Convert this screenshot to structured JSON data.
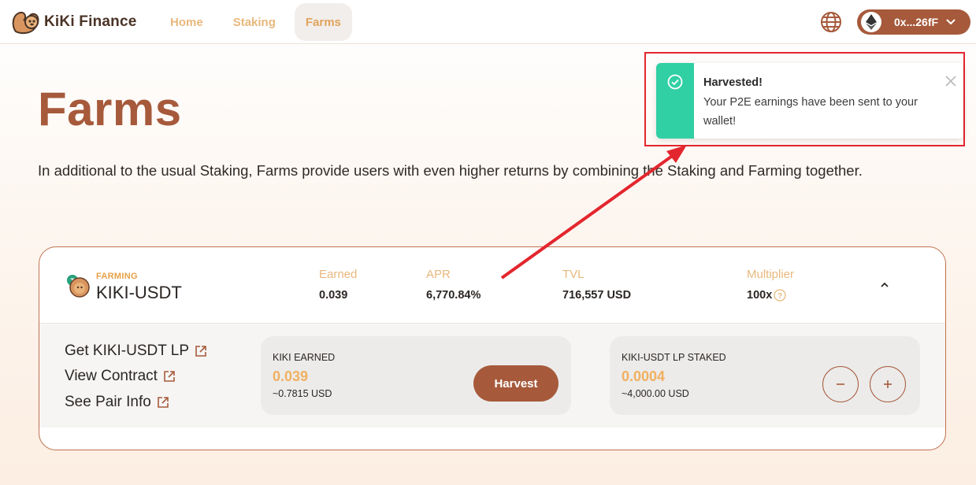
{
  "header": {
    "brand": "KiKi Finance",
    "nav": [
      {
        "label": "Home",
        "active": false
      },
      {
        "label": "Staking",
        "active": false
      },
      {
        "label": "Farms",
        "active": true
      }
    ],
    "wallet_address": "0x...26fF",
    "icons": [
      "squirrel-logo-icon",
      "globe-icon",
      "ethereum-icon",
      "chevron-down-icon"
    ]
  },
  "page": {
    "title": "Farms",
    "description": "In additional to the usual Staking, Farms provide users with even higher returns by combining the Staking and Farming together."
  },
  "toast": {
    "title": "Harvested!",
    "message": "Your P2E earnings have been sent to your wallet!",
    "accent": "#31cfa4"
  },
  "farm": {
    "tag": "FARMING",
    "pair": "KIKI-USDT",
    "stats": [
      {
        "label": "Earned",
        "value": "0.039"
      },
      {
        "label": "APR",
        "value": "6,770.84%"
      },
      {
        "label": "TVL",
        "value": "716,557 USD"
      },
      {
        "label": "Multiplier",
        "value": "100x"
      }
    ],
    "links": [
      "Get KIKI-USDT LP",
      "View Contract",
      "See Pair Info"
    ],
    "earned_panel": {
      "label": "KIKI EARNED",
      "value": "0.039",
      "usd": "~0.7815 USD",
      "button": "Harvest"
    },
    "staked_panel": {
      "label": "KIKI-USDT LP STAKED",
      "value": "0.0004",
      "usd": "~4,000.00 USD"
    }
  },
  "colors": {
    "brand": "#a65a3b",
    "nav_text": "#e8b87c",
    "highlight": "#e3262e",
    "value_orange": "#f0b061"
  }
}
